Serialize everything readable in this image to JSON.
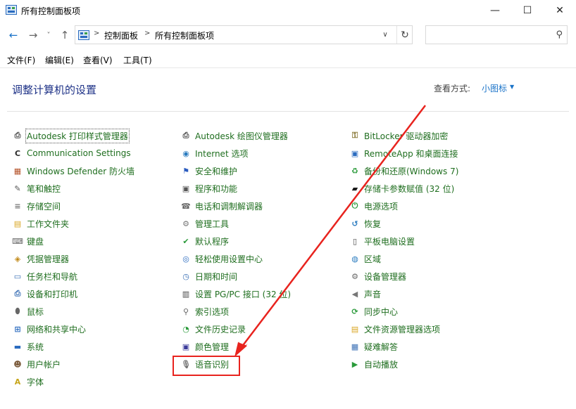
{
  "window": {
    "title": "所有控制面板项",
    "controls": {
      "minimize": "—",
      "maximize": "☐",
      "close": "✕"
    }
  },
  "address_bar": {
    "back": "←",
    "forward": "→",
    "recent": "˅",
    "up": "↑",
    "breadcrumbs": [
      "控制面板",
      "所有控制面板项"
    ],
    "separator": ">",
    "dropdown": "∨",
    "refresh": "↻",
    "search_icon": "⚲",
    "search_value": "",
    "search_placeholder": ""
  },
  "menus": [
    "文件(F)",
    "编辑(E)",
    "查看(V)",
    "工具(T)"
  ],
  "heading": "调整计算机的设置",
  "view_by": {
    "label": "查看方式:",
    "value": "小图标",
    "dropdown": "▼"
  },
  "columns": [
    [
      {
        "label": "Autodesk 打印样式管理器",
        "icon": "printer-icon",
        "glyph": "⎙",
        "color": "#4a4a4a"
      },
      {
        "label": "Communication Settings",
        "icon": "com-icon",
        "glyph": "C",
        "color": "#2b2b2b"
      },
      {
        "label": "Windows Defender 防火墙",
        "icon": "firewall-icon",
        "glyph": "▦",
        "color": "#b5532a"
      },
      {
        "label": "笔和触控",
        "icon": "pen-icon",
        "glyph": "✎",
        "color": "#555555"
      },
      {
        "label": "存储空间",
        "icon": "storage-icon",
        "glyph": "≡",
        "color": "#777777"
      },
      {
        "label": "工作文件夹",
        "icon": "folder-icon",
        "glyph": "▤",
        "color": "#d9a520"
      },
      {
        "label": "键盘",
        "icon": "keyboard-icon",
        "glyph": "⌨",
        "color": "#666666"
      },
      {
        "label": "凭据管理器",
        "icon": "credential-icon",
        "glyph": "◈",
        "color": "#c28a1a"
      },
      {
        "label": "任务栏和导航",
        "icon": "taskbar-icon",
        "glyph": "▭",
        "color": "#3a6fb5"
      },
      {
        "label": "设备和打印机",
        "icon": "devices-icon",
        "glyph": "⎙",
        "color": "#3a6fb5"
      },
      {
        "label": "鼠标",
        "icon": "mouse-icon",
        "glyph": "⬮",
        "color": "#666666"
      },
      {
        "label": "网络和共享中心",
        "icon": "network-icon",
        "glyph": "⊞",
        "color": "#2a6bbf"
      },
      {
        "label": "系统",
        "icon": "system-icon",
        "glyph": "▬",
        "color": "#2a6bbf"
      },
      {
        "label": "用户帐户",
        "icon": "users-icon",
        "glyph": "☻",
        "color": "#7a5a3a"
      },
      {
        "label": "字体",
        "icon": "font-icon",
        "glyph": "A",
        "color": "#c7a51a"
      }
    ],
    [
      {
        "label": "Autodesk 绘图仪管理器",
        "icon": "plotter-icon",
        "glyph": "⎙",
        "color": "#4a4a4a"
      },
      {
        "label": "Internet 选项",
        "icon": "internet-icon",
        "glyph": "◉",
        "color": "#2a7bbf"
      },
      {
        "label": "安全和维护",
        "icon": "flag-icon",
        "glyph": "⚑",
        "color": "#2a5bbf"
      },
      {
        "label": "程序和功能",
        "icon": "programs-icon",
        "glyph": "▣",
        "color": "#555555"
      },
      {
        "label": "电话和调制解调器",
        "icon": "phone-icon",
        "glyph": "☎",
        "color": "#666666"
      },
      {
        "label": "管理工具",
        "icon": "tools-icon",
        "glyph": "⚙",
        "color": "#777777"
      },
      {
        "label": "默认程序",
        "icon": "default-programs-icon",
        "glyph": "✔",
        "color": "#2a9a3a"
      },
      {
        "label": "轻松使用设置中心",
        "icon": "ease-icon",
        "glyph": "◎",
        "color": "#2a6bbf"
      },
      {
        "label": "日期和时间",
        "icon": "clock-icon",
        "glyph": "◷",
        "color": "#3a6fb5"
      },
      {
        "label": "设置 PG/PC 接口 (32 位)",
        "icon": "pgpc-icon",
        "glyph": "▥",
        "color": "#444444"
      },
      {
        "label": "索引选项",
        "icon": "index-icon",
        "glyph": "⚲",
        "color": "#666666"
      },
      {
        "label": "文件历史记录",
        "icon": "history-icon",
        "glyph": "◔",
        "color": "#2a9a3a"
      },
      {
        "label": "颜色管理",
        "icon": "color-icon",
        "glyph": "▣",
        "color": "#3a3a9a"
      },
      {
        "label": "语音识别",
        "icon": "microphone-icon",
        "glyph": "🎙",
        "color": "#777777"
      }
    ],
    [
      {
        "label": "BitLocker 驱动器加密",
        "icon": "bitlocker-icon",
        "glyph": "⚿",
        "color": "#8a7a3a"
      },
      {
        "label": "RemoteApp 和桌面连接",
        "icon": "remoteapp-icon",
        "glyph": "▣",
        "color": "#2a6bbf"
      },
      {
        "label": "备份和还原(Windows 7)",
        "icon": "backup-icon",
        "glyph": "♻",
        "color": "#2a9a3a"
      },
      {
        "label": "存储卡参数赋值 (32 位)",
        "icon": "memcard-icon",
        "glyph": "▰",
        "color": "#1a1a1a"
      },
      {
        "label": "电源选项",
        "icon": "power-icon",
        "glyph": "⏻",
        "color": "#2a9a3a"
      },
      {
        "label": "恢复",
        "icon": "recovery-icon",
        "glyph": "↺",
        "color": "#2a7bbf"
      },
      {
        "label": "平板电脑设置",
        "icon": "tablet-icon",
        "glyph": "▯",
        "color": "#444444"
      },
      {
        "label": "区域",
        "icon": "region-icon",
        "glyph": "◍",
        "color": "#2a7bbf"
      },
      {
        "label": "设备管理器",
        "icon": "device-manager-icon",
        "glyph": "⚙",
        "color": "#666666"
      },
      {
        "label": "声音",
        "icon": "speaker-icon",
        "glyph": "◀",
        "color": "#777777"
      },
      {
        "label": "同步中心",
        "icon": "sync-icon",
        "glyph": "⟳",
        "color": "#2a9a3a"
      },
      {
        "label": "文件资源管理器选项",
        "icon": "explorer-options-icon",
        "glyph": "▤",
        "color": "#d9a520"
      },
      {
        "label": "疑难解答",
        "icon": "troubleshoot-icon",
        "glyph": "▦",
        "color": "#3a6fb5"
      },
      {
        "label": "自动播放",
        "icon": "autoplay-icon",
        "glyph": "▶",
        "color": "#2a9a3a"
      }
    ]
  ]
}
